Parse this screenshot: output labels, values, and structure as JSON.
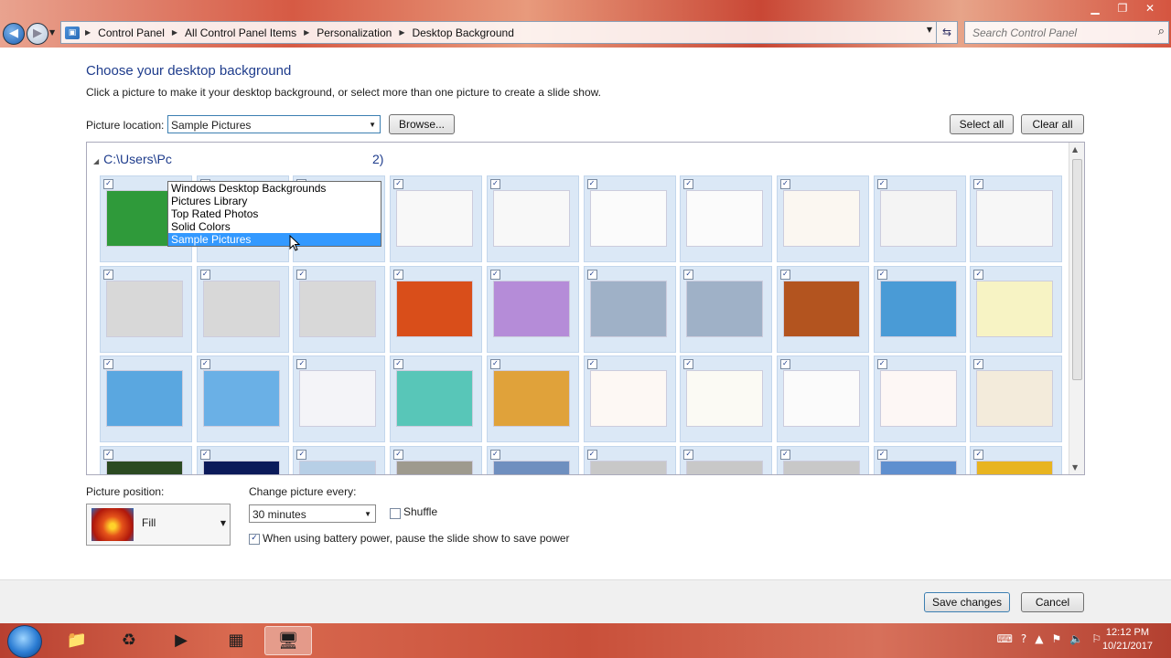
{
  "window": {
    "minimize": "▁",
    "maximize": "❐",
    "close": "✕"
  },
  "breadcrumbs": [
    "Control Panel",
    "All Control Panel Items",
    "Personalization",
    "Desktop Background"
  ],
  "search": {
    "placeholder": "Search Control Panel"
  },
  "page": {
    "title": "Choose your desktop background",
    "subtitle": "Click a picture to make it your desktop background, or select more than one picture to create a slide show.",
    "location_label": "Picture location:",
    "location_value": "Sample Pictures",
    "browse_label": "Browse...",
    "select_all_label": "Select all",
    "clear_all_label": "Clear all",
    "group_header": "C:\\Users\\Pc",
    "group_header_suffix": "2)"
  },
  "location_options": [
    "Windows Desktop Backgrounds",
    "Pictures Library",
    "Top Rated Photos",
    "Solid Colors",
    "Sample Pictures"
  ],
  "selected_option_index": 4,
  "thumbnails": [
    {
      "name": "woman-green-screen",
      "bg": "#2f9a3a",
      "checked": true
    },
    {
      "name": "flower-field",
      "bg": "#7ca33a",
      "checked": true
    },
    {
      "name": "floor-plan-sketch",
      "bg": "#faf6ef",
      "checked": true
    },
    {
      "name": "cad-drawing-1",
      "bg": "#f8f8f8",
      "checked": true
    },
    {
      "name": "cad-drawing-2",
      "bg": "#f8f8f8",
      "checked": true
    },
    {
      "name": "star-outline",
      "bg": "#fbfbfb",
      "checked": true
    },
    {
      "name": "venn-circles",
      "bg": "#fbfbfb",
      "checked": true
    },
    {
      "name": "puzzle-outline",
      "bg": "#fbf7f1",
      "checked": true
    },
    {
      "name": "cad-3d-part",
      "bg": "#f4f4f4",
      "checked": true
    },
    {
      "name": "cad-drawing-3",
      "bg": "#f7f7f7",
      "checked": true
    },
    {
      "name": "cd-autocad",
      "bg": "#d8d8d8",
      "checked": true
    },
    {
      "name": "cd-powerpoint",
      "bg": "#d8d8d8",
      "checked": true
    },
    {
      "name": "cd-blank",
      "bg": "#d8d8d8",
      "checked": true
    },
    {
      "name": "orange-chrysanthemum",
      "bg": "#d94e1a",
      "checked": true
    },
    {
      "name": "do-logo-rainbow",
      "bg": "#b58cd8",
      "checked": true
    },
    {
      "name": "typing-hands-1",
      "bg": "#9fb1c7",
      "checked": true
    },
    {
      "name": "typing-hands-2",
      "bg": "#9fb1c7",
      "checked": true
    },
    {
      "name": "desert-butte",
      "bg": "#b3541f",
      "checked": true
    },
    {
      "name": "do-logo-small",
      "bg": "#4a9bd6",
      "checked": true
    },
    {
      "name": "spreadsheet-yellow",
      "bg": "#f7f3c4",
      "checked": true
    },
    {
      "name": "spreadsheet-blue",
      "bg": "#5aa7e0",
      "checked": true
    },
    {
      "name": "list-blue",
      "bg": "#6ab0e6",
      "checked": true
    },
    {
      "name": "bar-chart",
      "bg": "#f4f4f8",
      "checked": true
    },
    {
      "name": "table-colored",
      "bg": "#58c6b8",
      "checked": true
    },
    {
      "name": "table-multicolor",
      "bg": "#e0a23a",
      "checked": true
    },
    {
      "name": "floral-frame",
      "bg": "#fdf8f4",
      "checked": true
    },
    {
      "name": "floral-corner",
      "bg": "#fbfaf4",
      "checked": true
    },
    {
      "name": "black-swirl",
      "bg": "#fbfbfb",
      "checked": true
    },
    {
      "name": "floral-wreath",
      "bg": "#fdf7f5",
      "checked": true
    },
    {
      "name": "brown-ornament",
      "bg": "#f3ebdb",
      "checked": true
    },
    {
      "name": "dark-green",
      "bg": "#2b4a22",
      "checked": true
    },
    {
      "name": "dark-blue",
      "bg": "#0b1a5a",
      "checked": true
    },
    {
      "name": "blue-cows",
      "bg": "#b7cfe6",
      "checked": true
    },
    {
      "name": "koala",
      "bg": "#9e9a8e",
      "checked": true
    },
    {
      "name": "lighthouse",
      "bg": "#6f8fbf",
      "checked": true
    },
    {
      "name": "cd-word",
      "bg": "#c8c8c8",
      "checked": true
    },
    {
      "name": "cd-powerpoint-2",
      "bg": "#c8c8c8",
      "checked": true
    },
    {
      "name": "cd-word-2",
      "bg": "#c8c8c8",
      "checked": true
    },
    {
      "name": "penguins",
      "bg": "#5f8fcf",
      "checked": true
    },
    {
      "name": "tulips",
      "bg": "#e8b420",
      "checked": true
    }
  ],
  "position": {
    "label": "Picture position:",
    "value": "Fill"
  },
  "change": {
    "label": "Change picture every:",
    "value": "30 minutes"
  },
  "shuffle": {
    "label": "Shuffle",
    "checked": false
  },
  "battery": {
    "label": "When using battery power, pause the slide show to save power",
    "checked": true
  },
  "footer": {
    "save_label": "Save changes",
    "cancel_label": "Cancel"
  },
  "clock": {
    "time": "12:12 PM",
    "date": "10/21/2017"
  },
  "taskbar_apps": [
    {
      "name": "file-explorer-icon",
      "glyph": "📁",
      "active": false
    },
    {
      "name": "mp4-converter-icon",
      "glyph": "♻",
      "active": false
    },
    {
      "name": "media-player-icon",
      "glyph": "▶",
      "active": false
    },
    {
      "name": "office-apps-icon",
      "glyph": "▦",
      "active": false
    },
    {
      "name": "control-panel-icon",
      "glyph": "🖥",
      "active": true
    }
  ]
}
